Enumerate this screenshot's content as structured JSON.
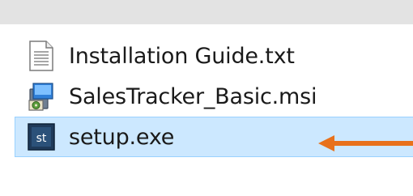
{
  "files": [
    {
      "name": "Installation Guide.txt",
      "icon": "text-document-icon",
      "selected": false
    },
    {
      "name": "SalesTracker_Basic.msi",
      "icon": "installer-package-icon",
      "selected": false
    },
    {
      "name": "setup.exe",
      "icon": "setup-exe-icon",
      "selected": true,
      "icon_text": "st"
    }
  ],
  "colors": {
    "selection_bg": "#cce8ff",
    "selection_border": "#99d1ff",
    "arrow": "#e8711c"
  }
}
